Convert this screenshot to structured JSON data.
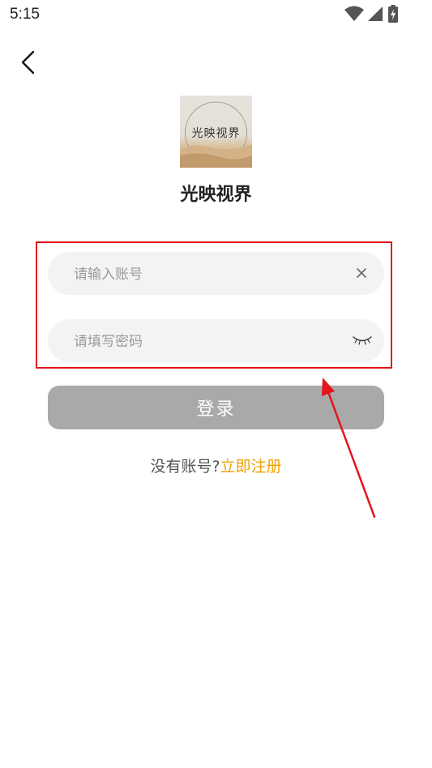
{
  "status_bar": {
    "time": "5:15",
    "icons": [
      "wifi-icon",
      "cellular-signal-icon",
      "battery-charging-icon"
    ]
  },
  "header": {
    "back_icon": "chevron-left-icon"
  },
  "app": {
    "logo_text": "光映视界",
    "name": "光映视界"
  },
  "form": {
    "account_placeholder": "请输入账号",
    "account_value": "",
    "password_placeholder": "请填写密码",
    "password_value": "",
    "clear_icon": "close-icon",
    "visibility_icon": "eye-closed-icon",
    "login_label": "登录"
  },
  "register": {
    "prompt": "没有账号?",
    "link": "立即注册"
  },
  "colors": {
    "annotation_red": "#e4141b",
    "link_orange": "#f0a000",
    "button_disabled_gray": "#a9a9a9",
    "field_background": "#f3f3f3"
  }
}
